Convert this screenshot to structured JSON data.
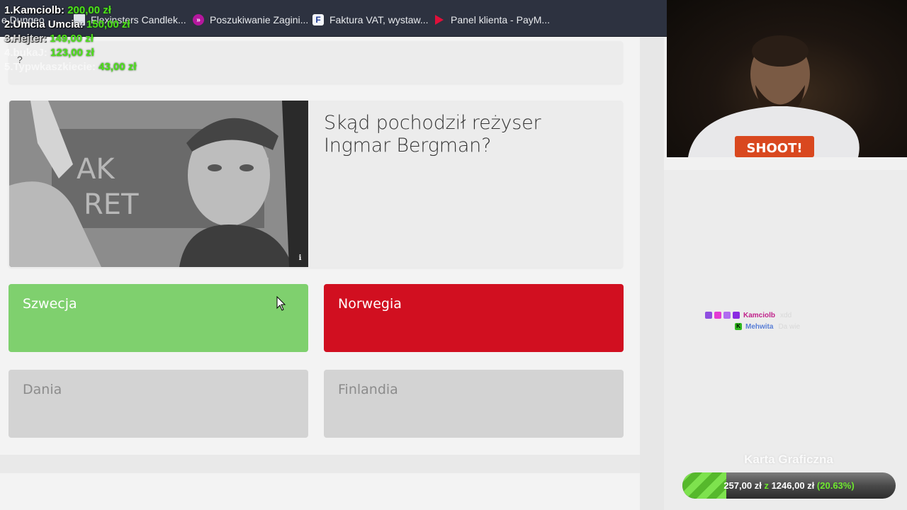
{
  "bookmarks": [
    {
      "label": "Flexinsters Candlek...",
      "icon": "document-icon"
    },
    {
      "label": "Poszukiwanie Zagini...",
      "icon": "circle-logo-icon"
    },
    {
      "label": "Faktura VAT, wystaw...",
      "icon": "f-logo-icon"
    },
    {
      "label": "Panel klienta - PayM...",
      "icon": "play-logo-icon"
    }
  ],
  "bookmark_partial": "e Dungeo",
  "top_card_mark": "?",
  "leaderboard": [
    {
      "name": "1.Kamciolb:",
      "amount": "200,00 zł"
    },
    {
      "name": "2.Umcia Umcia:",
      "amount": "150,00 zł"
    },
    {
      "name": "3.Hejter:",
      "amount": "149,00 zł"
    },
    {
      "name": "4.bukaJ:",
      "amount": "123,00 zł"
    },
    {
      "name": "5.Typwkaszkiecie:",
      "amount": "43,00 zł"
    }
  ],
  "quiz": {
    "question": "Skąd pochodził reżyser Ingmar Bergman?",
    "info_icon": "i",
    "answers": [
      {
        "label": "Szwecja",
        "state": "correct"
      },
      {
        "label": "Norwegia",
        "state": "wrong"
      },
      {
        "label": "Dania",
        "state": "neutral"
      },
      {
        "label": "Finlandia",
        "state": "neutral"
      }
    ]
  },
  "webcam": {
    "shirt_text": "SHOOT!"
  },
  "chat": [
    {
      "user": "Kamciolb",
      "message": "xdd"
    },
    {
      "user": "Mehwita",
      "message": "Da wie"
    }
  ],
  "goal": {
    "title": "Karta Graficzna",
    "current": "257,00 zł",
    "separator": "z",
    "target": "1246,00 zł",
    "percent_label": "(20.63%)",
    "progress": 0.2063
  },
  "colors": {
    "correct": "#7fd06e",
    "wrong": "#d10f20",
    "neutral": "#d3d3d3",
    "leaderboard_amount": "#4ee11b",
    "bookmarks_bar": "#2d3240"
  }
}
